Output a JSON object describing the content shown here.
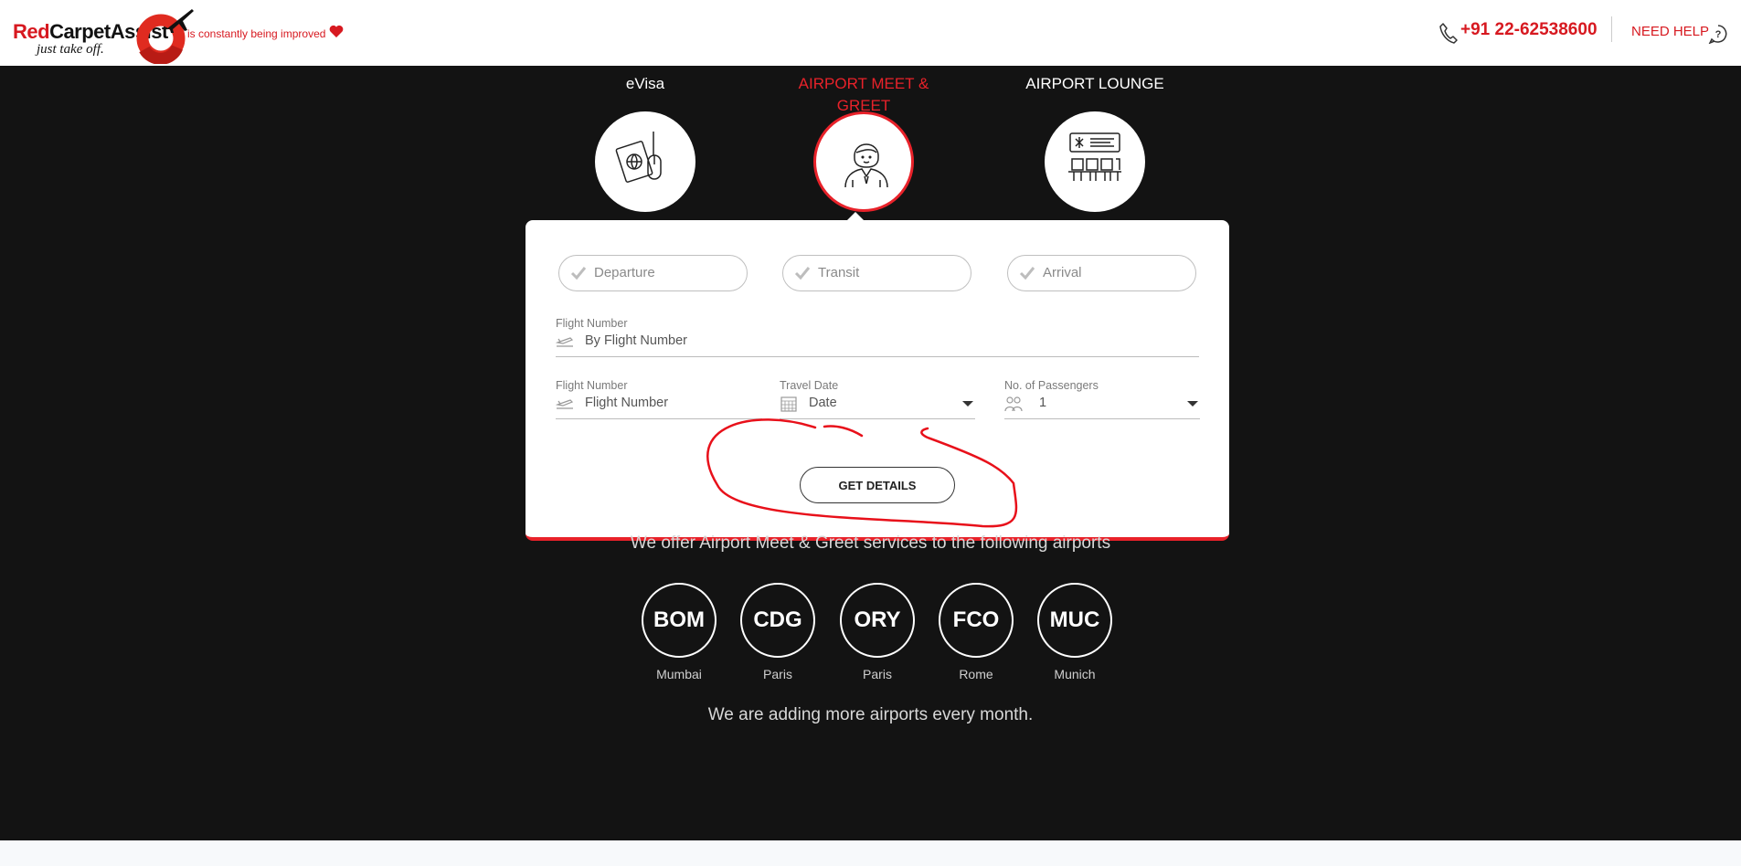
{
  "header": {
    "brand_red": "Red",
    "brand_black": "Carpet",
    "brand_rest": "Assist",
    "tagline": "just take off.",
    "improved_text": "is constantly being improved",
    "phone": "+91 22-62538600",
    "need_help": "NEED HELP"
  },
  "services": [
    {
      "label": "eVisa",
      "icon": "passport-mouse-icon",
      "active": false
    },
    {
      "label": "AIRPORT MEET & GREET",
      "icon": "greeter-person-icon",
      "active": true
    },
    {
      "label": "AIRPORT LOUNGE",
      "icon": "lounge-seats-icon",
      "active": false
    }
  ],
  "form": {
    "trip_types": [
      "Departure",
      "Transit",
      "Arrival"
    ],
    "search_label": "Flight Number",
    "search_placeholder": "By Flight Number",
    "flight_label": "Flight Number",
    "flight_placeholder": "Flight Number",
    "date_label": "Travel Date",
    "date_placeholder": "Date",
    "pax_label": "No. of Passengers",
    "pax_value": "1",
    "submit_label": "GET DETAILS"
  },
  "airports_section": {
    "intro": "We offer Airport Meet & Greet services to the following airports",
    "airports": [
      {
        "code": "BOM",
        "city": "Mumbai"
      },
      {
        "code": "CDG",
        "city": "Paris"
      },
      {
        "code": "ORY",
        "city": "Paris"
      },
      {
        "code": "FCO",
        "city": "Rome"
      },
      {
        "code": "MUC",
        "city": "Munich"
      }
    ],
    "footer_note": "We are adding more airports every month."
  },
  "colors": {
    "accent": "#e8222a",
    "dark_bg": "#131313"
  }
}
